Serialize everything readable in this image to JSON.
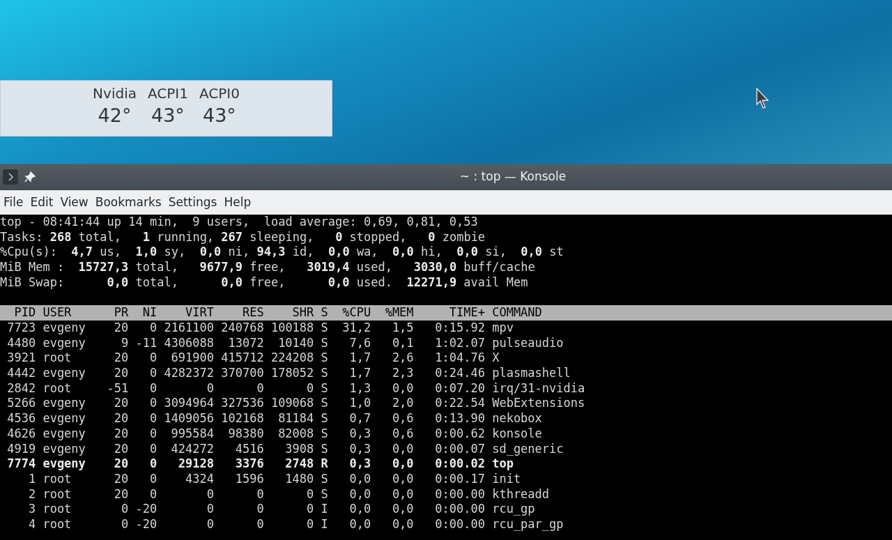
{
  "desktop": {
    "sensor_widget": {
      "sensors": [
        {
          "label": "Nvidia",
          "value": "42°"
        },
        {
          "label": "ACPI1",
          "value": "43°"
        },
        {
          "label": "ACPI0",
          "value": "43°"
        }
      ]
    }
  },
  "window": {
    "title": "~ : top — Konsole",
    "menu": [
      "File",
      "Edit",
      "View",
      "Bookmarks",
      "Settings",
      "Help"
    ]
  },
  "terminal": {
    "summary": [
      "top - 08:41:44 up 14 min,  9 users,  load average: 0,69, 0,81, 0,53",
      "Tasks: **268** total,   **1** running, **267** sleeping,   **0** stopped,   **0** zombie",
      "%Cpu(s):  **4,7** us,  **1,0** sy,  **0,0** ni, **94,3** id,  **0,0** wa,  **0,0** hi,  **0,0** si,  **0,0** st",
      "MiB Mem :  **15727,3** total,   **9677,9** free,   **3019,4** used,   **3030,0** buff/cache",
      "MiB Swap:      **0,0** total,      **0,0** free,      **0,0** used.  **12271,9** avail Mem"
    ],
    "columns": [
      "PID",
      "USER",
      "PR",
      "NI",
      "VIRT",
      "RES",
      "SHR",
      "S",
      "%CPU",
      "%MEM",
      "TIME+",
      "COMMAND"
    ],
    "processes": [
      {
        "bold": false,
        "cells": [
          "7723",
          "evgeny",
          "20",
          "0",
          "2161100",
          "240768",
          "100188",
          "S",
          "31,2",
          "1,5",
          "0:15.92",
          "mpv"
        ]
      },
      {
        "bold": false,
        "cells": [
          "4480",
          "evgeny",
          "9",
          "-11",
          "4306088",
          "13072",
          "10140",
          "S",
          "7,6",
          "0,1",
          "1:02.07",
          "pulseaudio"
        ]
      },
      {
        "bold": false,
        "cells": [
          "3921",
          "root",
          "20",
          "0",
          "691900",
          "415712",
          "224208",
          "S",
          "1,7",
          "2,6",
          "1:04.76",
          "X"
        ]
      },
      {
        "bold": false,
        "cells": [
          "4442",
          "evgeny",
          "20",
          "0",
          "4282372",
          "370700",
          "178052",
          "S",
          "1,7",
          "2,3",
          "0:24.46",
          "plasmashell"
        ]
      },
      {
        "bold": false,
        "cells": [
          "2842",
          "root",
          "-51",
          "0",
          "0",
          "0",
          "0",
          "S",
          "1,3",
          "0,0",
          "0:07.20",
          "irq/31-nvidia"
        ]
      },
      {
        "bold": false,
        "cells": [
          "5266",
          "evgeny",
          "20",
          "0",
          "3094964",
          "327536",
          "109068",
          "S",
          "1,0",
          "2,0",
          "0:22.54",
          "WebExtensions"
        ]
      },
      {
        "bold": false,
        "cells": [
          "4536",
          "evgeny",
          "20",
          "0",
          "1409056",
          "102168",
          "81184",
          "S",
          "0,7",
          "0,6",
          "0:13.90",
          "nekobox"
        ]
      },
      {
        "bold": false,
        "cells": [
          "4626",
          "evgeny",
          "20",
          "0",
          "995584",
          "98380",
          "82008",
          "S",
          "0,3",
          "0,6",
          "0:00.62",
          "konsole"
        ]
      },
      {
        "bold": false,
        "cells": [
          "4919",
          "evgeny",
          "20",
          "0",
          "424272",
          "4516",
          "3908",
          "S",
          "0,3",
          "0,0",
          "0:00.07",
          "sd_generic"
        ]
      },
      {
        "bold": true,
        "cells": [
          "7774",
          "evgeny",
          "20",
          "0",
          "29128",
          "3376",
          "2748",
          "R",
          "0,3",
          "0,0",
          "0:00.02",
          "top"
        ]
      },
      {
        "bold": false,
        "cells": [
          "1",
          "root",
          "20",
          "0",
          "4324",
          "1596",
          "1480",
          "S",
          "0,0",
          "0,0",
          "0:00.17",
          "init"
        ]
      },
      {
        "bold": false,
        "cells": [
          "2",
          "root",
          "20",
          "0",
          "0",
          "0",
          "0",
          "S",
          "0,0",
          "0,0",
          "0:00.00",
          "kthreadd"
        ]
      },
      {
        "bold": false,
        "cells": [
          "3",
          "root",
          "0",
          "-20",
          "0",
          "0",
          "0",
          "I",
          "0,0",
          "0,0",
          "0:00.00",
          "rcu_gp"
        ]
      },
      {
        "bold": false,
        "cells": [
          "4",
          "root",
          "0",
          "-20",
          "0",
          "0",
          "0",
          "I",
          "0,0",
          "0,0",
          "0:00.00",
          "rcu_par_gp"
        ]
      }
    ]
  }
}
